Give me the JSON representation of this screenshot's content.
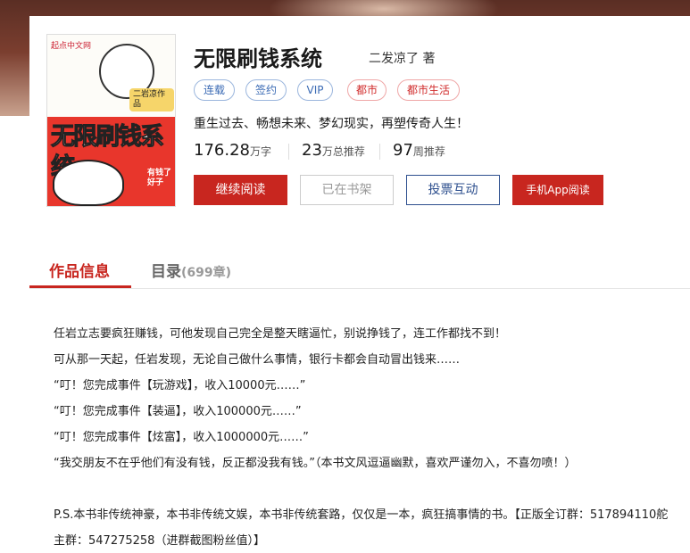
{
  "book": {
    "title": "无限刷钱系统",
    "author": "二发凉了 著",
    "tags": [
      {
        "label": "连载",
        "style": "blue"
      },
      {
        "label": "签约",
        "style": "blue"
      },
      {
        "label": "VIP",
        "style": "blue"
      },
      {
        "label": "都市",
        "style": "red"
      },
      {
        "label": "都市生活",
        "style": "red"
      }
    ],
    "intro": "重生过去、畅想未来、梦幻现实，再塑传奇人生！",
    "stats": [
      {
        "value": "176.28",
        "unit": "万字"
      },
      {
        "value": "23",
        "unit": "万总推荐"
      },
      {
        "value": "97",
        "unit": "周推荐"
      }
    ],
    "cover": {
      "logo": "起点中文网",
      "title": "无限刷钱系统",
      "tag_text": "二岩凉作品",
      "side_text": "有钱了 好子"
    }
  },
  "buttons": {
    "continue_read": "继续阅读",
    "on_shelf": "已在书架",
    "vote": "投票互动",
    "app_read": "手机App阅读"
  },
  "tabs": {
    "info": "作品信息",
    "catalog": "目录",
    "catalog_count": "(699章)"
  },
  "description": {
    "lines": [
      "任岩立志要疯狂赚钱，可他发现自己完全是整天瞎逼忙，别说挣钱了，连工作都找不到！",
      "可从那一天起，任岩发现，无论自己做什么事情，银行卡都会自动冒出钱来……",
      "“叮！您完成事件【玩游戏】，收入10000元……”",
      "“叮！您完成事件【装逼】，收入100000元……”",
      "“叮！您完成事件【炫富】，收入1000000元……”",
      "“我交朋友不在乎他们有没有钱，反正都没我有钱。”（本书文风逗逼幽默，喜欢严谨勿入，不喜勿喷！）"
    ],
    "ps": "P.S.本书非传统神豪，本书非传统文娱，本书非传统套路，仅仅是一本，疯狂搞事情的书。【正版全订群：517894110舵主群：547275258（进群截图粉丝值）】"
  },
  "colors": {
    "accent": "#c8261f",
    "blue_tag": "#3a6ab4",
    "vote_blue": "#2d4f8e"
  }
}
